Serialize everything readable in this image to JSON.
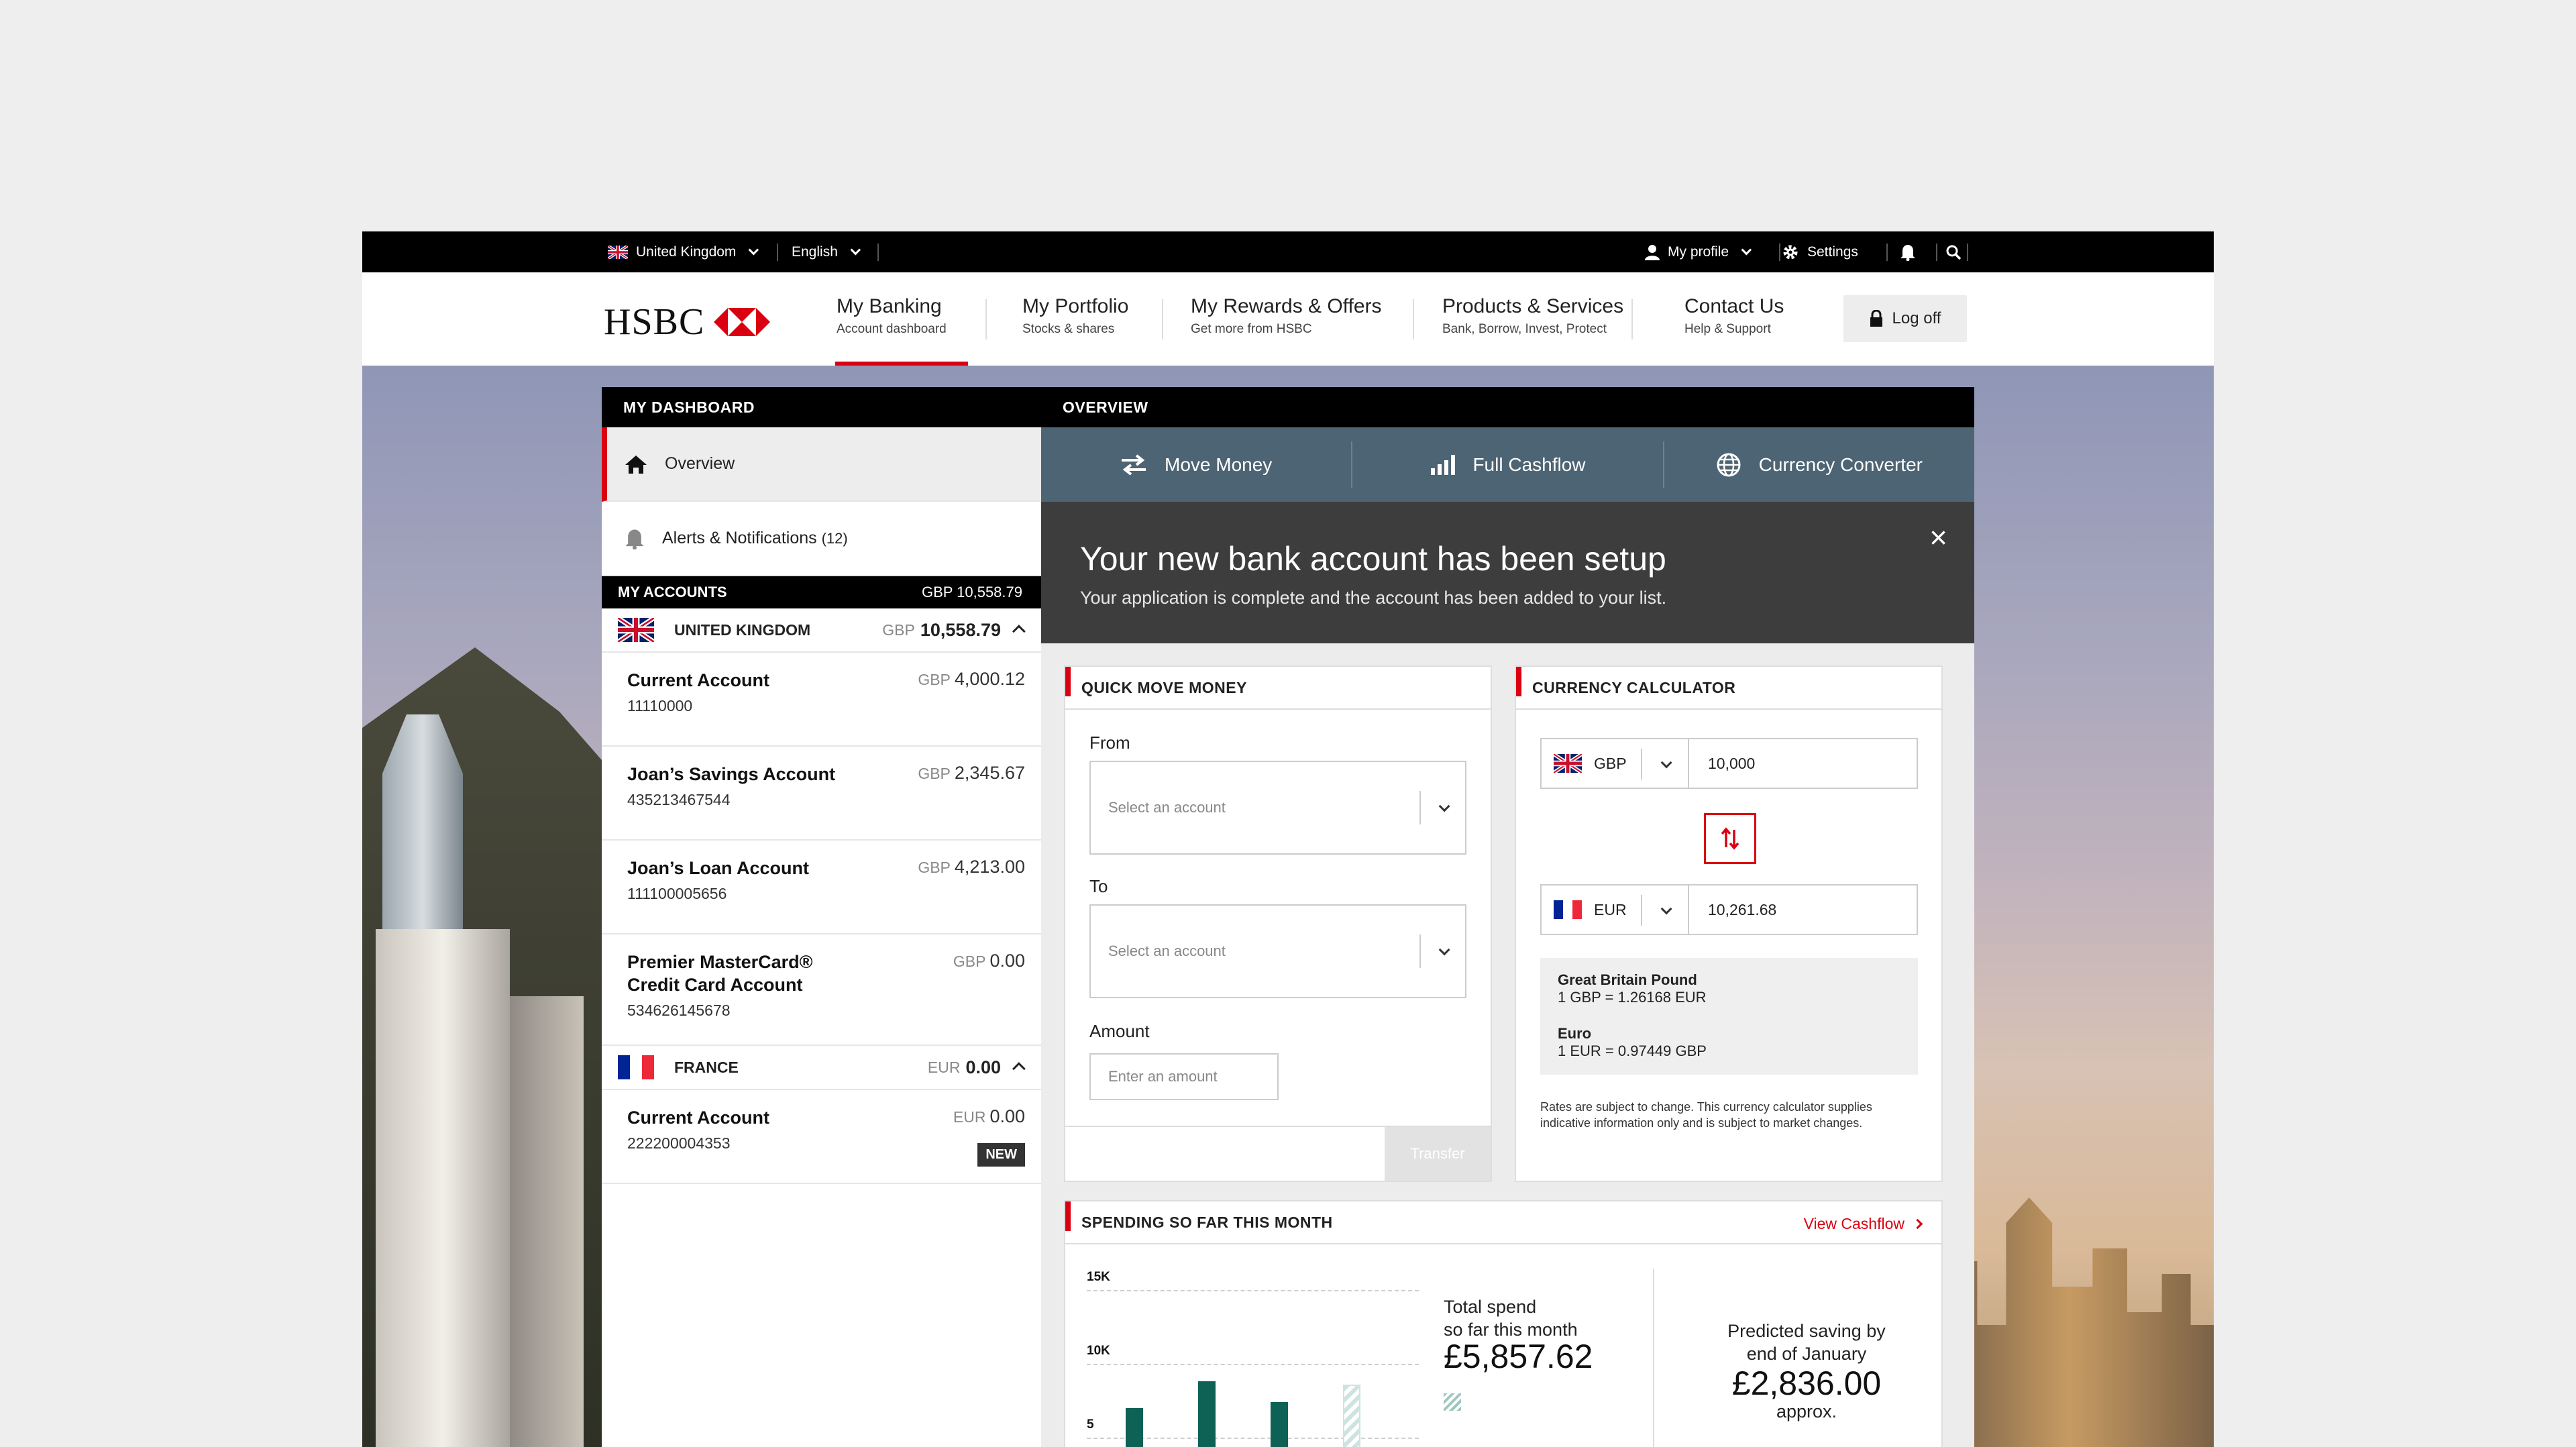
{
  "utility_bar": {
    "country": "United Kingdom",
    "language": "English",
    "profile": "My profile",
    "settings": "Settings"
  },
  "brand": {
    "name": "HSBC",
    "accent": "#db0011"
  },
  "nav": {
    "items": [
      {
        "title": "My Banking",
        "sub": "Account dashboard"
      },
      {
        "title": "My Portfolio",
        "sub": "Stocks & shares"
      },
      {
        "title": "My Rewards & Offers",
        "sub": "Get more from HSBC"
      },
      {
        "title": "Products & Services",
        "sub": "Bank, Borrow, Invest, Protect"
      },
      {
        "title": "Contact Us",
        "sub": "Help & Support"
      }
    ],
    "logoff": "Log off"
  },
  "sidebar": {
    "header": "MY DASHBOARD",
    "items": [
      {
        "label": "Overview",
        "icon": "home-icon"
      },
      {
        "label": "Alerts & Notifications",
        "count": "(12)",
        "icon": "bell-icon"
      }
    ],
    "my_accounts": {
      "label": "MY ACCOUNTS",
      "total": "GBP 10,558.79"
    },
    "regions": [
      {
        "name": "UNITED KINGDOM",
        "currency": "GBP",
        "balance": "10,558.79",
        "accounts": [
          {
            "name": "Current Account",
            "number": "11110000",
            "currency": "GBP",
            "amount": "4,000.12"
          },
          {
            "name": "Joan’s Savings Account",
            "number": "435213467544",
            "currency": "GBP",
            "amount": "2,345.67"
          },
          {
            "name": "Joan’s Loan Account",
            "number": "111100005656",
            "currency": "GBP",
            "amount": "4,213.00"
          },
          {
            "name": "Premier MasterCard®",
            "name2": "Credit Card Account",
            "number": "534626145678",
            "currency": "GBP",
            "amount": "0.00"
          }
        ]
      },
      {
        "name": "FRANCE",
        "currency": "EUR",
        "balance": "0.00",
        "accounts": [
          {
            "name": "Current Account",
            "number": "222200004353",
            "currency": "EUR",
            "amount": "0.00",
            "badge": "NEW"
          }
        ]
      }
    ]
  },
  "overview": {
    "header": "OVERVIEW",
    "tools": [
      {
        "label": "Move Money",
        "icon": "transfer-arrows-icon"
      },
      {
        "label": "Full Cashflow",
        "icon": "bar-chart-icon"
      },
      {
        "label": "Currency Converter",
        "icon": "globe-icon"
      }
    ],
    "banner": {
      "title": "Your new bank account has been setup",
      "subtitle": "Your application is complete and the account has been added to your list."
    }
  },
  "quick_move": {
    "title": "QUICK MOVE MONEY",
    "from_label": "From",
    "from_placeholder": "Select an account",
    "to_label": "To",
    "to_placeholder": "Select an account",
    "amount_label": "Amount",
    "amount_placeholder": "Enter an amount",
    "transfer": "Transfer"
  },
  "currency_calc": {
    "title": "CURRENCY CALCULATOR",
    "from_currency": "GBP",
    "from_value": "10,000",
    "to_currency": "EUR",
    "to_value": "10,261.68",
    "rates": [
      {
        "name": "Great Britain Pound",
        "rate": "1 GBP = 1.26168 EUR"
      },
      {
        "name": "Euro",
        "rate": "1 EUR = 0.97449 GBP"
      }
    ],
    "disclaimer": "Rates are subject to change. This currency calculator supplies indicative information only and is subject to market changes."
  },
  "spending": {
    "title": "SPENDING SO FAR THIS MONTH",
    "link": "View Cashflow",
    "total_label_1": "Total spend",
    "total_label_2": "so far this month",
    "total_value": "£5,857.62",
    "predicted_label_1": "Predicted saving by",
    "predicted_label_2": "end of January",
    "predicted_value": "£2,836.00",
    "predicted_suffix": "approx."
  },
  "chart_data": {
    "type": "bar",
    "yticks": [
      "15K",
      "10K",
      "5"
    ],
    "ylim": [
      0,
      15000
    ],
    "series": [
      {
        "values": [
          7000,
          8800,
          7400
        ]
      },
      {
        "values": [
          8600
        ]
      }
    ],
    "colors": {
      "actual": "#0d6155",
      "predicted": "#cde3df"
    }
  }
}
